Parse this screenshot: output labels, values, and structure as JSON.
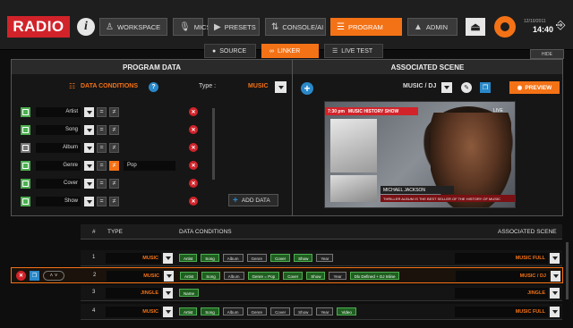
{
  "app": {
    "logo": "RADIO",
    "info": "i"
  },
  "nav": [
    {
      "label": "WORKSPACE",
      "icon": "user-icon",
      "glyph": "♙",
      "active": false
    },
    {
      "label": "MICS",
      "icon": "mic-icon",
      "glyph": "🎙",
      "active": false
    },
    {
      "label": "PRESETS",
      "icon": "presets-icon",
      "glyph": "▶",
      "active": false
    },
    {
      "label": "CONSOLE/AI",
      "icon": "console-icon",
      "glyph": "⇅",
      "active": false
    },
    {
      "label": "PROGRAM",
      "icon": "list-icon",
      "glyph": "☰",
      "active": true
    },
    {
      "label": "ADMIN",
      "icon": "lock-icon",
      "glyph": "▲",
      "active": false
    }
  ],
  "clock": {
    "date": "12/10/2011",
    "time": "14:40"
  },
  "subtabs": [
    {
      "label": "SOURCE",
      "glyph": "●",
      "active": false
    },
    {
      "label": "LINKER",
      "glyph": "∞",
      "active": true
    },
    {
      "label": "LIVE TEST",
      "glyph": "☰",
      "active": false
    }
  ],
  "hide_label": "HIDE",
  "program_data": {
    "title": "PROGRAM DATA",
    "dc_label": "DATA CONDITIONS",
    "help": "?",
    "type_label": "Type :",
    "type_value": "MUSIC",
    "rows": [
      {
        "field": "Artist",
        "active": true,
        "value": ""
      },
      {
        "field": "Song",
        "active": true,
        "value": ""
      },
      {
        "field": "Album",
        "active": false,
        "value": ""
      },
      {
        "field": "Genre",
        "active": true,
        "value": "Pop",
        "op_on": true
      },
      {
        "field": "Cover",
        "active": true,
        "value": ""
      },
      {
        "field": "Show",
        "active": true,
        "value": ""
      }
    ],
    "eq": "=",
    "neq": "≠",
    "add_label": "ADD DATA"
  },
  "scene": {
    "title": "ASSOCIATED SCENE",
    "selected": "MUSIC / DJ",
    "preview_label": "PREVIEW",
    "preview": {
      "banner": "MUSIC HISTORY SHOW",
      "banner_time": "7:30 pm",
      "live": "LIVE",
      "name": "MICHAEL JACKSON",
      "desc": "THRILLER ALBUM IS THE BEST SELLER OF THE HISTORY OF MUSIC"
    }
  },
  "table": {
    "headers": [
      "#",
      "TYPE",
      "DATA CONDITIONS",
      "ASSOCIATED SCENE"
    ],
    "rows": [
      {
        "num": "1",
        "type": "MUSIC",
        "scene": "MUSIC FULL",
        "chips": [
          {
            "t": "Artist",
            "g": true
          },
          {
            "t": "Song",
            "g": true
          },
          {
            "t": "Album",
            "g": false
          },
          {
            "t": "Genre",
            "g": false
          },
          {
            "t": "Cover",
            "g": true
          },
          {
            "t": "Show",
            "g": true
          },
          {
            "t": "Year",
            "g": false
          }
        ]
      },
      {
        "num": "2",
        "type": "MUSIC",
        "scene": "MUSIC / DJ",
        "chips": [
          {
            "t": "Artist",
            "g": true
          },
          {
            "t": "Song",
            "g": true
          },
          {
            "t": "Album",
            "g": false
          },
          {
            "t": "Genre = Pop",
            "g": true
          },
          {
            "t": "Cover",
            "g": true
          },
          {
            "t": "Show",
            "g": true
          },
          {
            "t": "Year",
            "g": false
          },
          {
            "t": "Dlx Defined + DJ Inline",
            "g": true
          }
        ]
      },
      {
        "num": "3",
        "type": "JINGLE",
        "scene": "JINGLE",
        "chips": [
          {
            "t": "Name",
            "g": true
          }
        ]
      },
      {
        "num": "4",
        "type": "MUSIC",
        "scene": "MUSIC FULL",
        "chips": [
          {
            "t": "Artist",
            "g": true
          },
          {
            "t": "Song",
            "g": true
          },
          {
            "t": "Album",
            "g": false
          },
          {
            "t": "Genre",
            "g": false
          },
          {
            "t": "Cover",
            "g": false
          },
          {
            "t": "Show",
            "g": false
          },
          {
            "t": "Year",
            "g": false
          },
          {
            "t": "Video",
            "g": true
          }
        ]
      }
    ]
  }
}
